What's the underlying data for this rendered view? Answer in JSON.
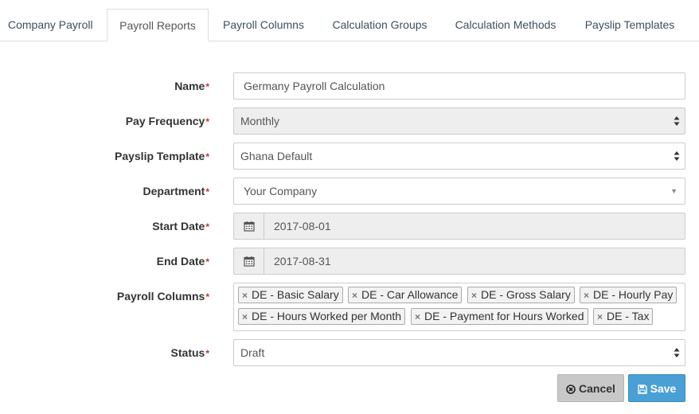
{
  "tabs": [
    {
      "label": "Company Payroll",
      "active": false
    },
    {
      "label": "Payroll Reports",
      "active": true
    },
    {
      "label": "Payroll Columns",
      "active": false
    },
    {
      "label": "Calculation Groups",
      "active": false
    },
    {
      "label": "Calculation Methods",
      "active": false
    },
    {
      "label": "Payslip Templates",
      "active": false
    }
  ],
  "form": {
    "name": {
      "label": "Name",
      "value": "Germany Payroll Calculation"
    },
    "pay_frequency": {
      "label": "Pay Frequency",
      "value": "Monthly"
    },
    "payslip_template": {
      "label": "Payslip Template",
      "value": "Ghana Default"
    },
    "department": {
      "label": "Department",
      "value": "Your Company"
    },
    "start_date": {
      "label": "Start Date",
      "value": "2017-08-01"
    },
    "end_date": {
      "label": "End Date",
      "value": "2017-08-31"
    },
    "payroll_columns": {
      "label": "Payroll Columns",
      "chips": [
        "DE - Basic Salary",
        "DE - Car Allowance",
        "DE - Gross Salary",
        "DE - Hourly Pay",
        "DE - Hours Worked per Month",
        "DE - Payment for Hours Worked",
        "DE - Tax"
      ]
    },
    "status": {
      "label": "Status",
      "value": "Draft"
    },
    "required_mark": "*"
  },
  "actions": {
    "cancel_label": "Cancel",
    "save_label": "Save"
  },
  "icons": {
    "calendar": "calendar-icon",
    "cancel": "times-circle-icon",
    "save": "floppy-disk-icon",
    "chip_remove": "×"
  },
  "colors": {
    "required": "#c0392b",
    "save_button": "#4a9fd5",
    "cancel_button": "#c8c8c8",
    "tab_text": "#3d4f5c"
  }
}
